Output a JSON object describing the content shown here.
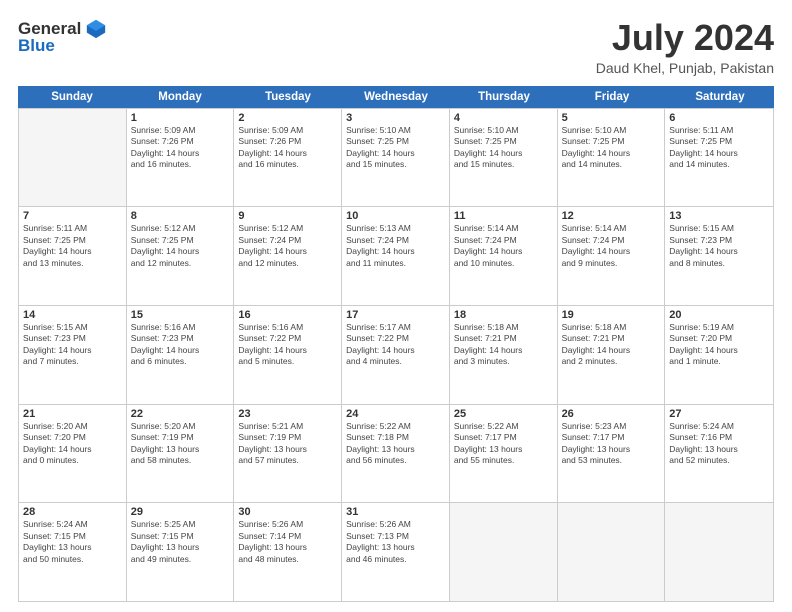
{
  "logo": {
    "general": "General",
    "blue": "Blue"
  },
  "title": "July 2024",
  "location": "Daud Khel, Punjab, Pakistan",
  "days": [
    "Sunday",
    "Monday",
    "Tuesday",
    "Wednesday",
    "Thursday",
    "Friday",
    "Saturday"
  ],
  "weeks": [
    [
      {
        "day": "",
        "info": ""
      },
      {
        "day": "1",
        "info": "Sunrise: 5:09 AM\nSunset: 7:26 PM\nDaylight: 14 hours\nand 16 minutes."
      },
      {
        "day": "2",
        "info": "Sunrise: 5:09 AM\nSunset: 7:26 PM\nDaylight: 14 hours\nand 16 minutes."
      },
      {
        "day": "3",
        "info": "Sunrise: 5:10 AM\nSunset: 7:25 PM\nDaylight: 14 hours\nand 15 minutes."
      },
      {
        "day": "4",
        "info": "Sunrise: 5:10 AM\nSunset: 7:25 PM\nDaylight: 14 hours\nand 15 minutes."
      },
      {
        "day": "5",
        "info": "Sunrise: 5:10 AM\nSunset: 7:25 PM\nDaylight: 14 hours\nand 14 minutes."
      },
      {
        "day": "6",
        "info": "Sunrise: 5:11 AM\nSunset: 7:25 PM\nDaylight: 14 hours\nand 14 minutes."
      }
    ],
    [
      {
        "day": "7",
        "info": "Sunrise: 5:11 AM\nSunset: 7:25 PM\nDaylight: 14 hours\nand 13 minutes."
      },
      {
        "day": "8",
        "info": "Sunrise: 5:12 AM\nSunset: 7:25 PM\nDaylight: 14 hours\nand 12 minutes."
      },
      {
        "day": "9",
        "info": "Sunrise: 5:12 AM\nSunset: 7:24 PM\nDaylight: 14 hours\nand 12 minutes."
      },
      {
        "day": "10",
        "info": "Sunrise: 5:13 AM\nSunset: 7:24 PM\nDaylight: 14 hours\nand 11 minutes."
      },
      {
        "day": "11",
        "info": "Sunrise: 5:14 AM\nSunset: 7:24 PM\nDaylight: 14 hours\nand 10 minutes."
      },
      {
        "day": "12",
        "info": "Sunrise: 5:14 AM\nSunset: 7:24 PM\nDaylight: 14 hours\nand 9 minutes."
      },
      {
        "day": "13",
        "info": "Sunrise: 5:15 AM\nSunset: 7:23 PM\nDaylight: 14 hours\nand 8 minutes."
      }
    ],
    [
      {
        "day": "14",
        "info": "Sunrise: 5:15 AM\nSunset: 7:23 PM\nDaylight: 14 hours\nand 7 minutes."
      },
      {
        "day": "15",
        "info": "Sunrise: 5:16 AM\nSunset: 7:23 PM\nDaylight: 14 hours\nand 6 minutes."
      },
      {
        "day": "16",
        "info": "Sunrise: 5:16 AM\nSunset: 7:22 PM\nDaylight: 14 hours\nand 5 minutes."
      },
      {
        "day": "17",
        "info": "Sunrise: 5:17 AM\nSunset: 7:22 PM\nDaylight: 14 hours\nand 4 minutes."
      },
      {
        "day": "18",
        "info": "Sunrise: 5:18 AM\nSunset: 7:21 PM\nDaylight: 14 hours\nand 3 minutes."
      },
      {
        "day": "19",
        "info": "Sunrise: 5:18 AM\nSunset: 7:21 PM\nDaylight: 14 hours\nand 2 minutes."
      },
      {
        "day": "20",
        "info": "Sunrise: 5:19 AM\nSunset: 7:20 PM\nDaylight: 14 hours\nand 1 minute."
      }
    ],
    [
      {
        "day": "21",
        "info": "Sunrise: 5:20 AM\nSunset: 7:20 PM\nDaylight: 14 hours\nand 0 minutes."
      },
      {
        "day": "22",
        "info": "Sunrise: 5:20 AM\nSunset: 7:19 PM\nDaylight: 13 hours\nand 58 minutes."
      },
      {
        "day": "23",
        "info": "Sunrise: 5:21 AM\nSunset: 7:19 PM\nDaylight: 13 hours\nand 57 minutes."
      },
      {
        "day": "24",
        "info": "Sunrise: 5:22 AM\nSunset: 7:18 PM\nDaylight: 13 hours\nand 56 minutes."
      },
      {
        "day": "25",
        "info": "Sunrise: 5:22 AM\nSunset: 7:17 PM\nDaylight: 13 hours\nand 55 minutes."
      },
      {
        "day": "26",
        "info": "Sunrise: 5:23 AM\nSunset: 7:17 PM\nDaylight: 13 hours\nand 53 minutes."
      },
      {
        "day": "27",
        "info": "Sunrise: 5:24 AM\nSunset: 7:16 PM\nDaylight: 13 hours\nand 52 minutes."
      }
    ],
    [
      {
        "day": "28",
        "info": "Sunrise: 5:24 AM\nSunset: 7:15 PM\nDaylight: 13 hours\nand 50 minutes."
      },
      {
        "day": "29",
        "info": "Sunrise: 5:25 AM\nSunset: 7:15 PM\nDaylight: 13 hours\nand 49 minutes."
      },
      {
        "day": "30",
        "info": "Sunrise: 5:26 AM\nSunset: 7:14 PM\nDaylight: 13 hours\nand 48 minutes."
      },
      {
        "day": "31",
        "info": "Sunrise: 5:26 AM\nSunset: 7:13 PM\nDaylight: 13 hours\nand 46 minutes."
      },
      {
        "day": "",
        "info": ""
      },
      {
        "day": "",
        "info": ""
      },
      {
        "day": "",
        "info": ""
      }
    ]
  ]
}
